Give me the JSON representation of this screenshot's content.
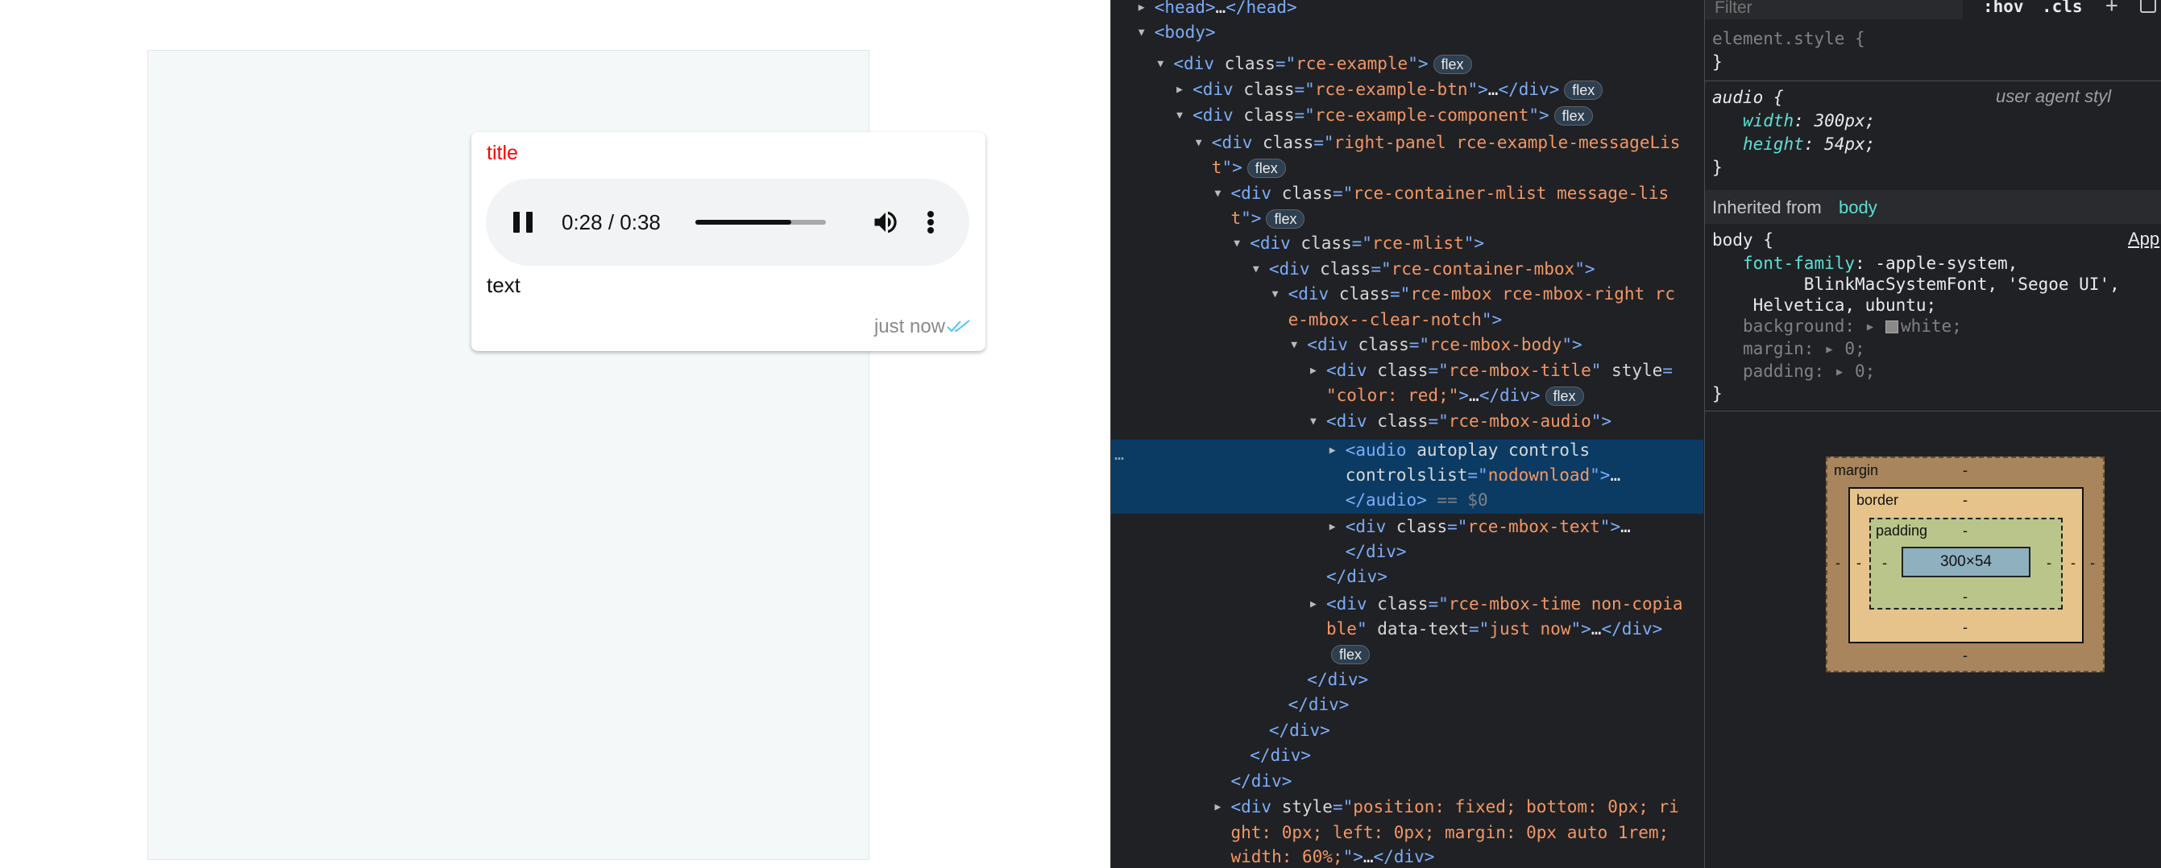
{
  "preview": {
    "message": {
      "title": "title",
      "title_color": "#ff0000",
      "text": "text",
      "time": "just now",
      "status": "read-double-check-icon",
      "status_color": "#4fc3f7"
    },
    "audio": {
      "time_display": "0:28 / 0:38",
      "progress_fraction": 0.737,
      "icons": {
        "pause": "pause-icon",
        "volume": "volume-icon",
        "more": "more-vert-icon"
      }
    }
  },
  "devtools": {
    "elements": {
      "lines": [
        {
          "indent": 1,
          "tri": "closed",
          "parts": [
            [
              "tag",
              "<head>"
            ],
            [
              "txt",
              "…"
            ],
            [
              "tag",
              "</head>"
            ]
          ]
        },
        {
          "indent": 1,
          "tri": "open",
          "parts": [
            [
              "tag",
              "<body>"
            ]
          ]
        },
        {
          "indent": 2,
          "tri": "open",
          "parts": [
            [
              "tag",
              "<div "
            ],
            [
              "aname",
              "class"
            ],
            [
              "tag",
              "=\""
            ],
            [
              "aval",
              "rce-example"
            ],
            [
              "tag",
              "\">"
            ]
          ],
          "badge": "flex"
        },
        {
          "indent": 3,
          "tri": "closed",
          "parts": [
            [
              "tag",
              "<div "
            ],
            [
              "aname",
              "class"
            ],
            [
              "tag",
              "=\""
            ],
            [
              "aval",
              "rce-example-btn"
            ],
            [
              "tag",
              "\">"
            ],
            [
              "txt",
              "…"
            ],
            [
              "tag",
              "</div>"
            ]
          ],
          "badge": "flex"
        },
        {
          "indent": 3,
          "tri": "open",
          "parts": [
            [
              "tag",
              "<div "
            ],
            [
              "aname",
              "class"
            ],
            [
              "tag",
              "=\""
            ],
            [
              "aval",
              "rce-example-component"
            ],
            [
              "tag",
              "\">"
            ]
          ],
          "badge": "flex"
        },
        {
          "indent": 4,
          "tri": "open",
          "parts": [
            [
              "tag",
              "<div "
            ],
            [
              "aname",
              "class"
            ],
            [
              "tag",
              "=\""
            ],
            [
              "aval",
              "right-panel rce-example-messageLis"
            ]
          ]
        },
        {
          "indent": 4,
          "tri": "none",
          "parts": [
            [
              "aval",
              "t"
            ],
            [
              "tag",
              "\">"
            ]
          ],
          "badge": "flex"
        },
        {
          "indent": 5,
          "tri": "open",
          "parts": [
            [
              "tag",
              "<div "
            ],
            [
              "aname",
              "class"
            ],
            [
              "tag",
              "=\""
            ],
            [
              "aval",
              "rce-container-mlist message-lis"
            ]
          ]
        },
        {
          "indent": 5,
          "tri": "none",
          "parts": [
            [
              "aval",
              "t"
            ],
            [
              "tag",
              "\">"
            ]
          ],
          "badge": "flex"
        },
        {
          "indent": 6,
          "tri": "open",
          "parts": [
            [
              "tag",
              "<div "
            ],
            [
              "aname",
              "class"
            ],
            [
              "tag",
              "=\""
            ],
            [
              "aval",
              "rce-mlist"
            ],
            [
              "tag",
              "\">"
            ]
          ]
        },
        {
          "indent": 7,
          "tri": "open",
          "parts": [
            [
              "tag",
              "<div "
            ],
            [
              "aname",
              "class"
            ],
            [
              "tag",
              "=\""
            ],
            [
              "aval",
              "rce-container-mbox"
            ],
            [
              "tag",
              "\">"
            ]
          ]
        },
        {
          "indent": 8,
          "tri": "open",
          "parts": [
            [
              "tag",
              "<div "
            ],
            [
              "aname",
              "class"
            ],
            [
              "tag",
              "=\""
            ],
            [
              "aval",
              "rce-mbox rce-mbox-right rc"
            ]
          ]
        },
        {
          "indent": 8,
          "tri": "none",
          "parts": [
            [
              "aval",
              "e-mbox--clear-notch"
            ],
            [
              "tag",
              "\">"
            ]
          ]
        },
        {
          "indent": 9,
          "tri": "open",
          "parts": [
            [
              "tag",
              "<div "
            ],
            [
              "aname",
              "class"
            ],
            [
              "tag",
              "=\""
            ],
            [
              "aval",
              "rce-mbox-body"
            ],
            [
              "tag",
              "\">"
            ]
          ]
        },
        {
          "indent": 10,
          "tri": "closed",
          "parts": [
            [
              "tag",
              "<div "
            ],
            [
              "aname",
              "class"
            ],
            [
              "tag",
              "=\""
            ],
            [
              "aval",
              "rce-mbox-title"
            ],
            [
              "tag",
              "\" "
            ],
            [
              "aname",
              "style"
            ],
            [
              "tag",
              "="
            ]
          ]
        },
        {
          "indent": 10,
          "tri": "none",
          "parts": [
            [
              "aval",
              "\"color: red;\""
            ],
            [
              "tag",
              ">"
            ],
            [
              "txt",
              "…"
            ],
            [
              "tag",
              "</div>"
            ]
          ],
          "badge": "flex"
        },
        {
          "indent": 10,
          "tri": "open",
          "parts": [
            [
              "tag",
              "<div "
            ],
            [
              "aname",
              "class"
            ],
            [
              "tag",
              "=\""
            ],
            [
              "aval",
              "rce-mbox-audio"
            ],
            [
              "tag",
              "\">"
            ]
          ]
        },
        {
          "indent": 11,
          "tri": "closed",
          "parts": [
            [
              "tag",
              "<audio "
            ],
            [
              "aname",
              "autoplay controls"
            ]
          ]
        },
        {
          "indent": 11,
          "tri": "none",
          "parts": [
            [
              "aname",
              "controlslist"
            ],
            [
              "tag",
              "=\""
            ],
            [
              "aval",
              "nodownload"
            ],
            [
              "tag",
              "\">"
            ],
            [
              "txt",
              "…"
            ]
          ]
        },
        {
          "indent": 11,
          "tri": "none",
          "parts": [
            [
              "tag",
              "</audio>"
            ],
            [
              "faded",
              " == $0"
            ]
          ]
        },
        {
          "indent": 11,
          "tri": "closed",
          "parts": [
            [
              "tag",
              "<div "
            ],
            [
              "aname",
              "class"
            ],
            [
              "tag",
              "=\""
            ],
            [
              "aval",
              "rce-mbox-text"
            ],
            [
              "tag",
              "\">"
            ],
            [
              "txt",
              "…"
            ]
          ]
        },
        {
          "indent": 11,
          "tri": "none",
          "parts": [
            [
              "tag",
              "</div>"
            ]
          ]
        },
        {
          "indent": 10,
          "tri": "none",
          "parts": [
            [
              "tag",
              "</div>"
            ]
          ]
        },
        {
          "indent": 10,
          "tri": "closed",
          "parts": [
            [
              "tag",
              "<div "
            ],
            [
              "aname",
              "class"
            ],
            [
              "tag",
              "=\""
            ],
            [
              "aval",
              "rce-mbox-time non-copia"
            ]
          ]
        },
        {
          "indent": 10,
          "tri": "none",
          "parts": [
            [
              "aval",
              "ble"
            ],
            [
              "tag",
              "\" "
            ],
            [
              "aname",
              "data-text"
            ],
            [
              "tag",
              "=\""
            ],
            [
              "aval",
              "just now"
            ],
            [
              "tag",
              "\">"
            ],
            [
              "txt",
              "…"
            ],
            [
              "tag",
              "</div>"
            ]
          ]
        },
        {
          "indent": 10,
          "tri": "none",
          "parts": [],
          "badge": "flex"
        },
        {
          "indent": 9,
          "tri": "none",
          "parts": [
            [
              "tag",
              "</div>"
            ]
          ]
        },
        {
          "indent": 8,
          "tri": "none",
          "parts": [
            [
              "tag",
              "</div>"
            ]
          ]
        },
        {
          "indent": 7,
          "tri": "none",
          "parts": [
            [
              "tag",
              "</div>"
            ]
          ]
        },
        {
          "indent": 6,
          "tri": "none",
          "parts": [
            [
              "tag",
              "</div>"
            ]
          ]
        },
        {
          "indent": 5,
          "tri": "none",
          "parts": [
            [
              "tag",
              "</div>"
            ]
          ]
        },
        {
          "indent": 5,
          "tri": "closed",
          "parts": [
            [
              "tag",
              "<div "
            ],
            [
              "aname",
              "style"
            ],
            [
              "tag",
              "=\""
            ],
            [
              "aval",
              "position: fixed; bottom: 0px; ri"
            ]
          ]
        },
        {
          "indent": 5,
          "tri": "none",
          "parts": [
            [
              "aval",
              "ght: 0px; left: 0px; margin: 0px auto 1rem;"
            ]
          ]
        },
        {
          "indent": 5,
          "tri": "none",
          "parts": [
            [
              "aval",
              "width: 60%;"
            ],
            [
              "tag",
              "\">"
            ],
            [
              "txt",
              "…"
            ],
            [
              "tag",
              "</div>"
            ]
          ]
        }
      ],
      "selected_marker": "…"
    },
    "styles": {
      "filter_placeholder": "Filter",
      "hov_label": ":hov",
      "cls_label": ".cls",
      "add_rule_label": "+",
      "element_style": "element.style {",
      "close_brace": "}",
      "audio_selector": "audio {",
      "ua_label": "user agent styl",
      "audio_width_prop": "width",
      "audio_width_val": "300px;",
      "audio_height_prop": "height",
      "audio_height_val": "54px;",
      "inherited_label": "Inherited from",
      "inherited_link": "body",
      "body_selector": "body {",
      "app_link": "App",
      "font_family_prop": "font-family",
      "font_family_l1": "-apple-system,",
      "font_family_l2": "BlinkMacSystemFont, 'Segoe UI',",
      "font_family_l3": "Helvetica, ubuntu;",
      "bg_prop": "background",
      "bg_val": "white;",
      "margin_prop": "margin",
      "margin_val": "0;",
      "padding_prop": "padding",
      "padding_val": "0;"
    },
    "box_model": {
      "margin_label": "margin",
      "border_label": "border",
      "padding_label": "padding",
      "content_size": "300×54",
      "dash": "-"
    }
  }
}
